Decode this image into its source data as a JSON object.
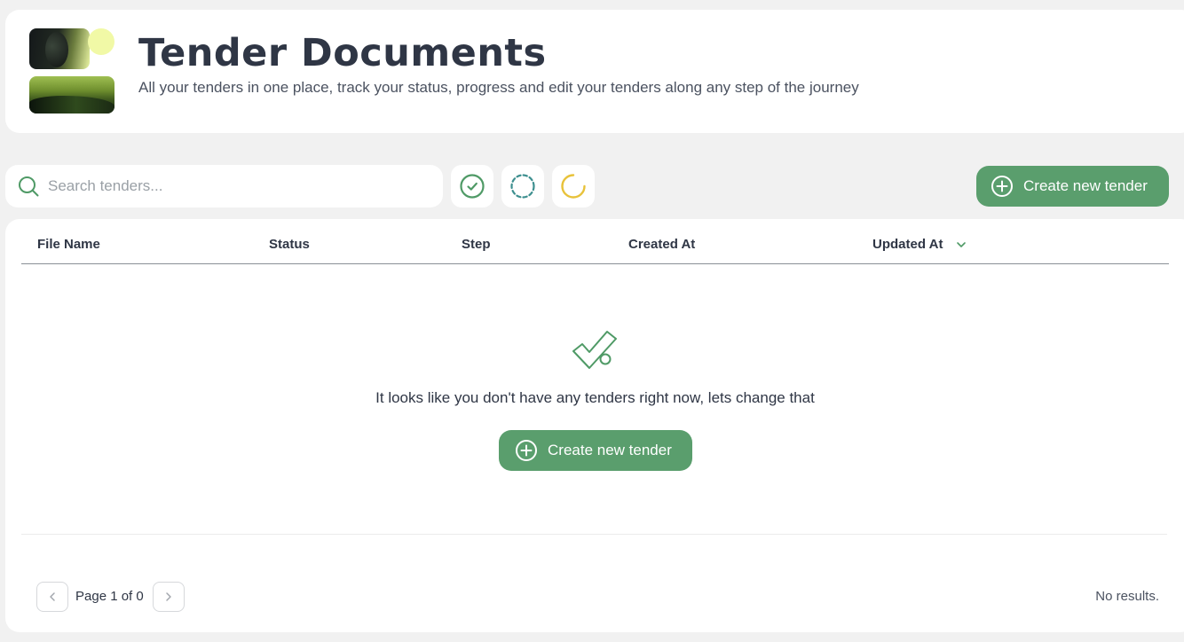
{
  "header": {
    "title": "Tender Documents",
    "subtitle": "All your tenders in one place, track your status, progress and edit your tenders along any step of the journey"
  },
  "toolbar": {
    "search_placeholder": "Search tenders...",
    "filters": [
      {
        "icon": "check-circle-icon",
        "color": "#4f9a66"
      },
      {
        "icon": "dashed-circle-icon",
        "color": "#3d8f8f"
      },
      {
        "icon": "loading-circle-icon",
        "color": "#e8c23a"
      }
    ],
    "create_button_label": "Create new tender"
  },
  "table": {
    "columns": [
      "File Name",
      "Status",
      "Step",
      "Created At",
      "Updated At"
    ],
    "sorted_column": "Updated At",
    "rows": []
  },
  "empty_state": {
    "icon": "empty-check-icon",
    "message": "It looks like you don't have any tenders right now, lets change that",
    "button_label": "Create new tender"
  },
  "pagination": {
    "page_label": "Page 1 of 0",
    "results_label": "No results."
  },
  "colors": {
    "accent": "#5a9e6d",
    "background": "#f1f1f1",
    "text": "#2f3645"
  }
}
